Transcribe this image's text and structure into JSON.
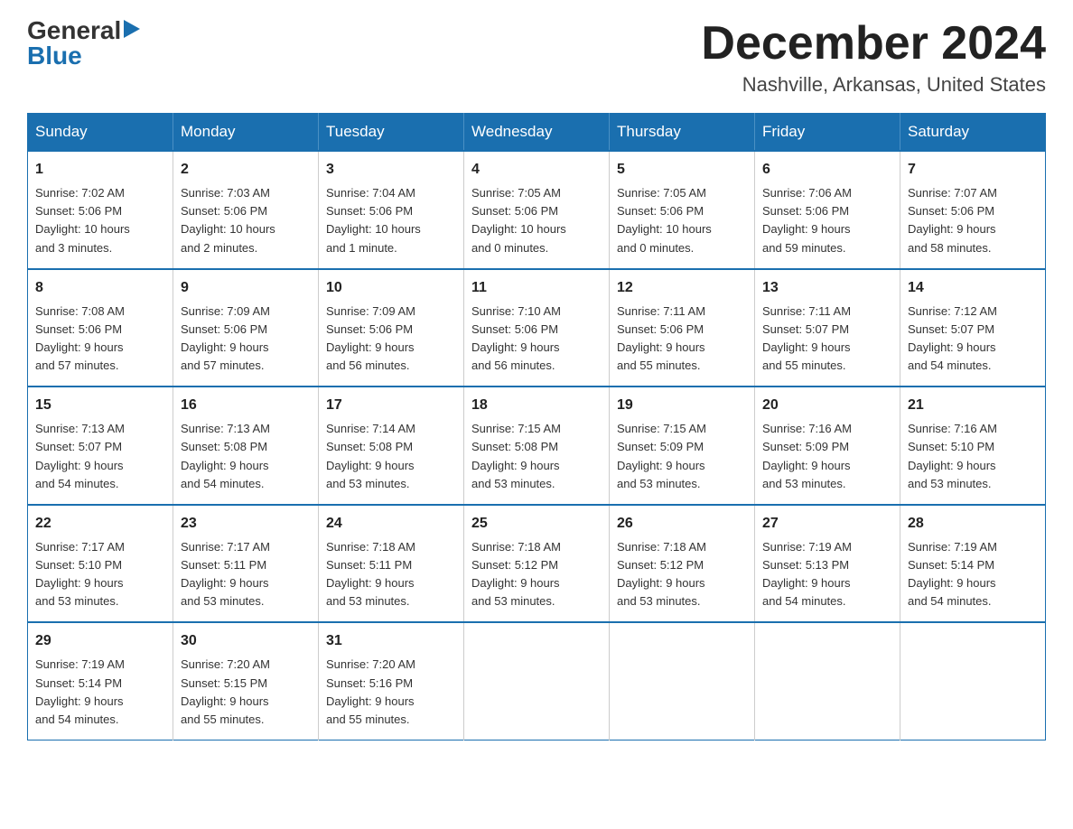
{
  "logo": {
    "general": "General",
    "blue": "Blue",
    "triangle": "▶"
  },
  "title": {
    "month_year": "December 2024",
    "location": "Nashville, Arkansas, United States"
  },
  "header": {
    "days": [
      "Sunday",
      "Monday",
      "Tuesday",
      "Wednesday",
      "Thursday",
      "Friday",
      "Saturday"
    ]
  },
  "weeks": [
    [
      {
        "day": "1",
        "info": "Sunrise: 7:02 AM\nSunset: 5:06 PM\nDaylight: 10 hours\nand 3 minutes."
      },
      {
        "day": "2",
        "info": "Sunrise: 7:03 AM\nSunset: 5:06 PM\nDaylight: 10 hours\nand 2 minutes."
      },
      {
        "day": "3",
        "info": "Sunrise: 7:04 AM\nSunset: 5:06 PM\nDaylight: 10 hours\nand 1 minute."
      },
      {
        "day": "4",
        "info": "Sunrise: 7:05 AM\nSunset: 5:06 PM\nDaylight: 10 hours\nand 0 minutes."
      },
      {
        "day": "5",
        "info": "Sunrise: 7:05 AM\nSunset: 5:06 PM\nDaylight: 10 hours\nand 0 minutes."
      },
      {
        "day": "6",
        "info": "Sunrise: 7:06 AM\nSunset: 5:06 PM\nDaylight: 9 hours\nand 59 minutes."
      },
      {
        "day": "7",
        "info": "Sunrise: 7:07 AM\nSunset: 5:06 PM\nDaylight: 9 hours\nand 58 minutes."
      }
    ],
    [
      {
        "day": "8",
        "info": "Sunrise: 7:08 AM\nSunset: 5:06 PM\nDaylight: 9 hours\nand 57 minutes."
      },
      {
        "day": "9",
        "info": "Sunrise: 7:09 AM\nSunset: 5:06 PM\nDaylight: 9 hours\nand 57 minutes."
      },
      {
        "day": "10",
        "info": "Sunrise: 7:09 AM\nSunset: 5:06 PM\nDaylight: 9 hours\nand 56 minutes."
      },
      {
        "day": "11",
        "info": "Sunrise: 7:10 AM\nSunset: 5:06 PM\nDaylight: 9 hours\nand 56 minutes."
      },
      {
        "day": "12",
        "info": "Sunrise: 7:11 AM\nSunset: 5:06 PM\nDaylight: 9 hours\nand 55 minutes."
      },
      {
        "day": "13",
        "info": "Sunrise: 7:11 AM\nSunset: 5:07 PM\nDaylight: 9 hours\nand 55 minutes."
      },
      {
        "day": "14",
        "info": "Sunrise: 7:12 AM\nSunset: 5:07 PM\nDaylight: 9 hours\nand 54 minutes."
      }
    ],
    [
      {
        "day": "15",
        "info": "Sunrise: 7:13 AM\nSunset: 5:07 PM\nDaylight: 9 hours\nand 54 minutes."
      },
      {
        "day": "16",
        "info": "Sunrise: 7:13 AM\nSunset: 5:08 PM\nDaylight: 9 hours\nand 54 minutes."
      },
      {
        "day": "17",
        "info": "Sunrise: 7:14 AM\nSunset: 5:08 PM\nDaylight: 9 hours\nand 53 minutes."
      },
      {
        "day": "18",
        "info": "Sunrise: 7:15 AM\nSunset: 5:08 PM\nDaylight: 9 hours\nand 53 minutes."
      },
      {
        "day": "19",
        "info": "Sunrise: 7:15 AM\nSunset: 5:09 PM\nDaylight: 9 hours\nand 53 minutes."
      },
      {
        "day": "20",
        "info": "Sunrise: 7:16 AM\nSunset: 5:09 PM\nDaylight: 9 hours\nand 53 minutes."
      },
      {
        "day": "21",
        "info": "Sunrise: 7:16 AM\nSunset: 5:10 PM\nDaylight: 9 hours\nand 53 minutes."
      }
    ],
    [
      {
        "day": "22",
        "info": "Sunrise: 7:17 AM\nSunset: 5:10 PM\nDaylight: 9 hours\nand 53 minutes."
      },
      {
        "day": "23",
        "info": "Sunrise: 7:17 AM\nSunset: 5:11 PM\nDaylight: 9 hours\nand 53 minutes."
      },
      {
        "day": "24",
        "info": "Sunrise: 7:18 AM\nSunset: 5:11 PM\nDaylight: 9 hours\nand 53 minutes."
      },
      {
        "day": "25",
        "info": "Sunrise: 7:18 AM\nSunset: 5:12 PM\nDaylight: 9 hours\nand 53 minutes."
      },
      {
        "day": "26",
        "info": "Sunrise: 7:18 AM\nSunset: 5:12 PM\nDaylight: 9 hours\nand 53 minutes."
      },
      {
        "day": "27",
        "info": "Sunrise: 7:19 AM\nSunset: 5:13 PM\nDaylight: 9 hours\nand 54 minutes."
      },
      {
        "day": "28",
        "info": "Sunrise: 7:19 AM\nSunset: 5:14 PM\nDaylight: 9 hours\nand 54 minutes."
      }
    ],
    [
      {
        "day": "29",
        "info": "Sunrise: 7:19 AM\nSunset: 5:14 PM\nDaylight: 9 hours\nand 54 minutes."
      },
      {
        "day": "30",
        "info": "Sunrise: 7:20 AM\nSunset: 5:15 PM\nDaylight: 9 hours\nand 55 minutes."
      },
      {
        "day": "31",
        "info": "Sunrise: 7:20 AM\nSunset: 5:16 PM\nDaylight: 9 hours\nand 55 minutes."
      },
      null,
      null,
      null,
      null
    ]
  ]
}
